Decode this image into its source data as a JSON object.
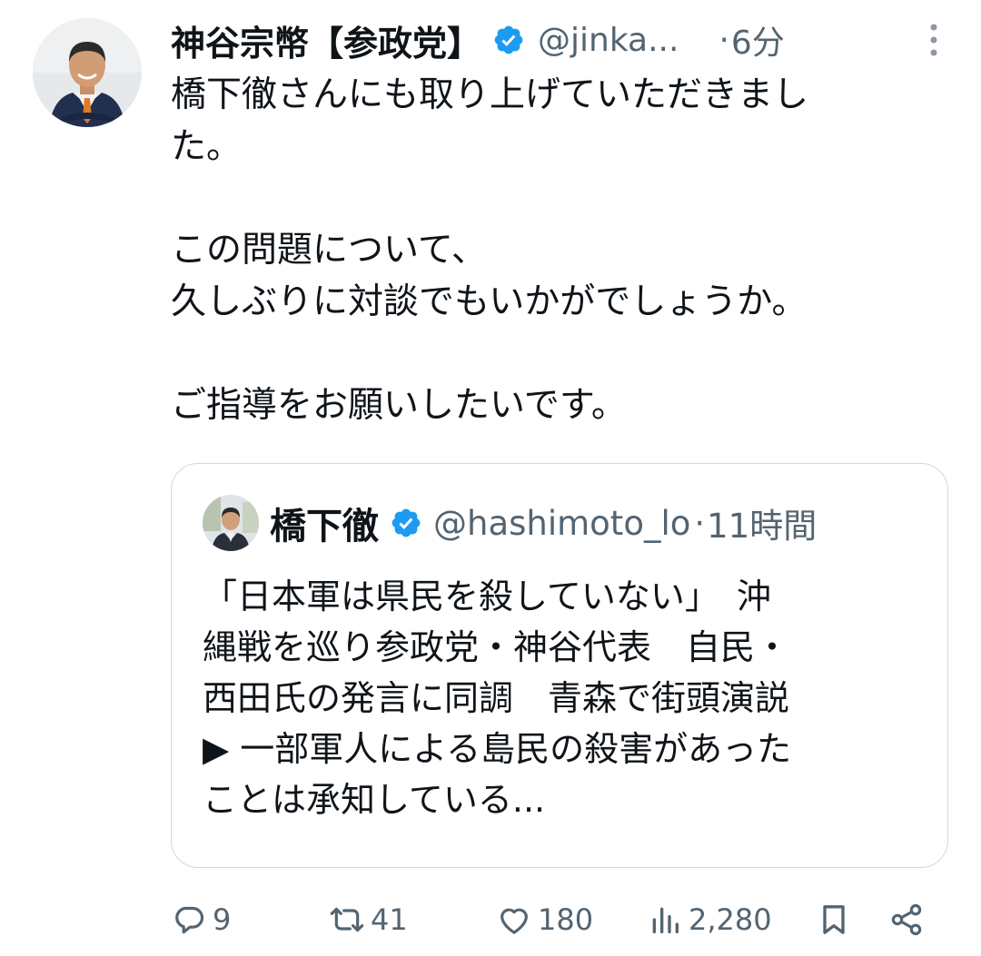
{
  "tweet": {
    "author": {
      "display_name": "神谷宗幣【参政党】",
      "handle": "@jinka...",
      "verified": true
    },
    "separator": "·",
    "time": "6分",
    "body": {
      "paragraphs": [
        [
          "橋下徹さんにも取り上げていただきまし",
          "た。"
        ],
        [
          "この問題について、",
          "久しぶりに対談でもいかがでしょうか。"
        ],
        [
          "ご指導をお願いしたいです。"
        ]
      ]
    },
    "quote": {
      "author": {
        "display_name": "橋下徹",
        "handle": "@hashimoto_lo",
        "verified": true
      },
      "separator": "·",
      "time": "11時間",
      "lines": [
        "「日本軍は県民を殺していない」　沖",
        "縄戦を巡り参政党・神谷代表　自民・",
        "西田氏の発言に同調　青森で街頭演説",
        "▶ 一部軍人による島民の殺害があった",
        "ことは承知している..."
      ]
    },
    "actions": {
      "replies": "9",
      "retweets": "41",
      "likes": "180",
      "views": "2,280"
    }
  },
  "colors": {
    "text": "#0f1419",
    "secondary": "#536471",
    "verified_blue": "#1d9bf0",
    "border": "#cfd9de"
  },
  "icons": [
    "more-vertical-icon",
    "verified-badge-icon",
    "reply-icon",
    "retweet-icon",
    "like-icon",
    "views-icon",
    "bookmark-icon",
    "share-icon"
  ]
}
